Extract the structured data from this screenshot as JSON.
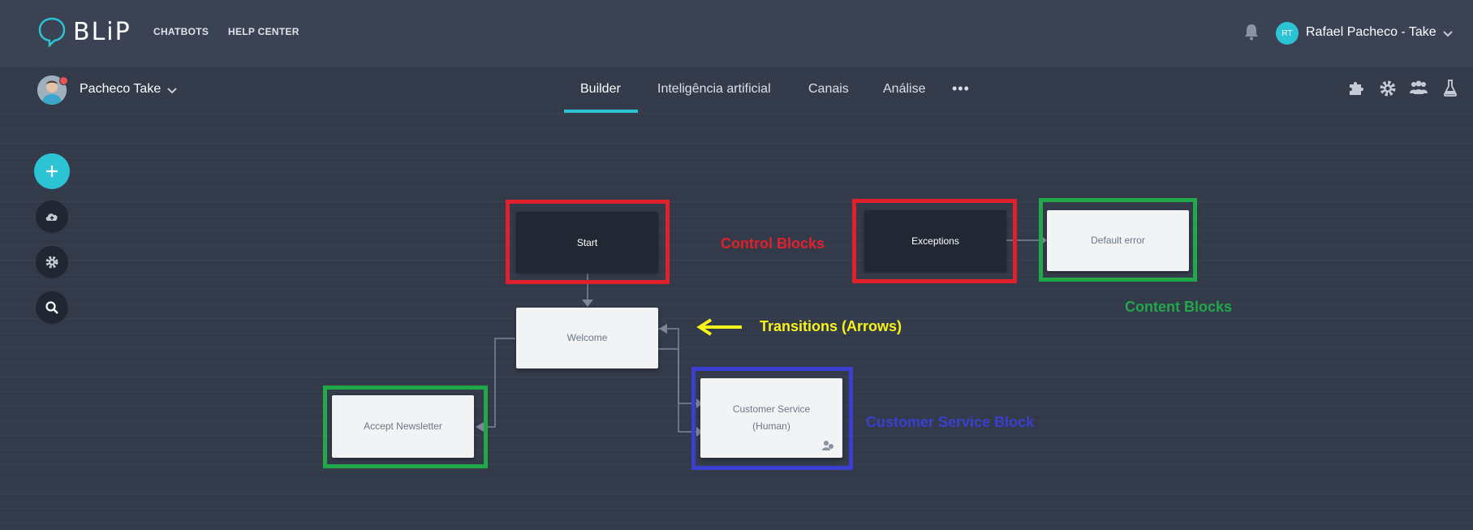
{
  "app": {
    "logo_text": "BLiP"
  },
  "topnav": {
    "chatbots": "CHATBOTS",
    "help_center": "HELP CENTER"
  },
  "user": {
    "initials": "RT",
    "name": "Rafael Pacheco - Take"
  },
  "bot": {
    "name": "Pacheco Take"
  },
  "tabs": [
    {
      "label": "Builder",
      "active": true
    },
    {
      "label": "Inteligência artificial",
      "active": false
    },
    {
      "label": "Canais",
      "active": false
    },
    {
      "label": "Análise",
      "active": false
    }
  ],
  "more_label": "•••",
  "toolbar_icons": [
    "puzzle-icon",
    "gear-icon",
    "team-icon",
    "flask-icon"
  ],
  "side_actions": [
    "add-icon",
    "cloud-upload-icon",
    "gear-icon",
    "search-icon"
  ],
  "blocks": {
    "start": "Start",
    "exceptions": "Exceptions",
    "default_error": "Default error",
    "welcome": "Welcome",
    "accept_newsletter": "Accept Newsletter",
    "customer_service_line1": "Customer Service",
    "customer_service_line2": "(Human)"
  },
  "annotations": {
    "control_blocks": "Control Blocks",
    "content_blocks": "Content Blocks",
    "transitions": "Transitions (Arrows)",
    "customer_service_block": "Customer Service Block"
  },
  "colors": {
    "accent": "#2cc3d5",
    "annotation_red": "#e0202b",
    "annotation_green": "#21a84a",
    "annotation_blue": "#3a3fcf",
    "annotation_yellow": "#f7f21a"
  }
}
